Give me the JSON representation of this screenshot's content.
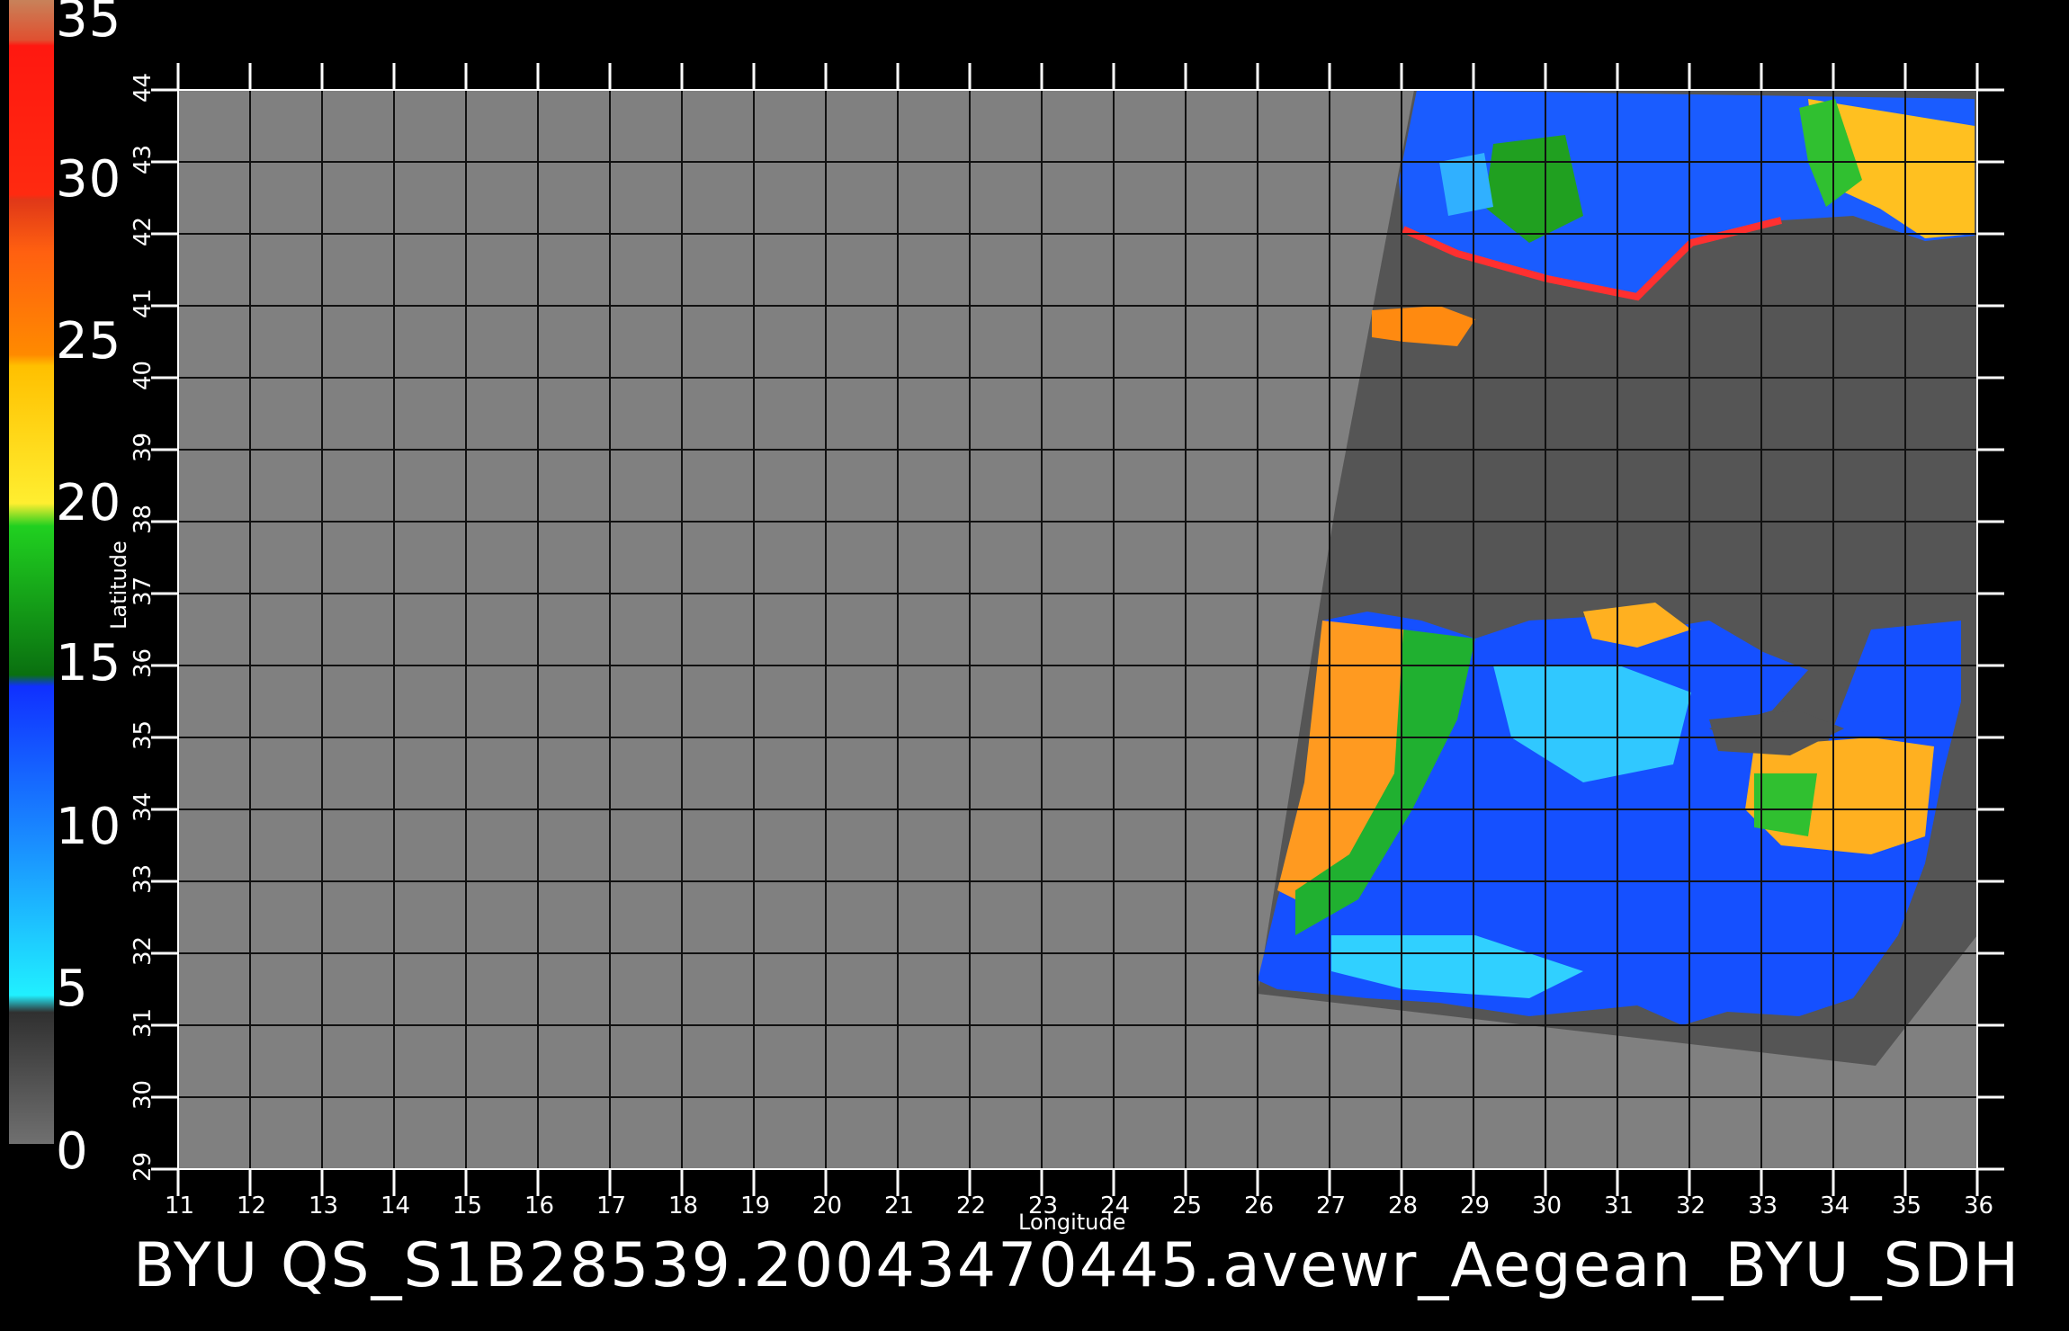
{
  "title": "BYU  QS_S1B28539.20043470445.avewr_Aegean_BYU_SDH",
  "colorbar": {
    "labels": [
      "35",
      "30",
      "25",
      "20",
      "15",
      "10",
      "5",
      "0"
    ],
    "colors": {
      "c35": "#c8825a",
      "c30_35": "#ff2010",
      "c25_30": "#ff6a00",
      "c20_25": "#ffe000",
      "c15_20": "#10b010",
      "c10_15": "#1040ff",
      "c5_10": "#20e8ff",
      "c0_5": "#606060"
    }
  },
  "axes": {
    "xlabel": "Longitude",
    "ylabel": "Latitude",
    "x_ticks": [
      "11",
      "12",
      "13",
      "14",
      "15",
      "16",
      "17",
      "18",
      "19",
      "20",
      "21",
      "22",
      "23",
      "24",
      "25",
      "26",
      "27",
      "28",
      "29",
      "30",
      "31",
      "32",
      "33",
      "34",
      "35",
      "36"
    ],
    "y_ticks": [
      "29",
      "30",
      "31",
      "32",
      "33",
      "34",
      "35",
      "36",
      "37",
      "38",
      "39",
      "40",
      "41",
      "42",
      "43",
      "44"
    ]
  },
  "map": {
    "background": "#808080",
    "swath": "#555555",
    "grid": "#111111"
  }
}
